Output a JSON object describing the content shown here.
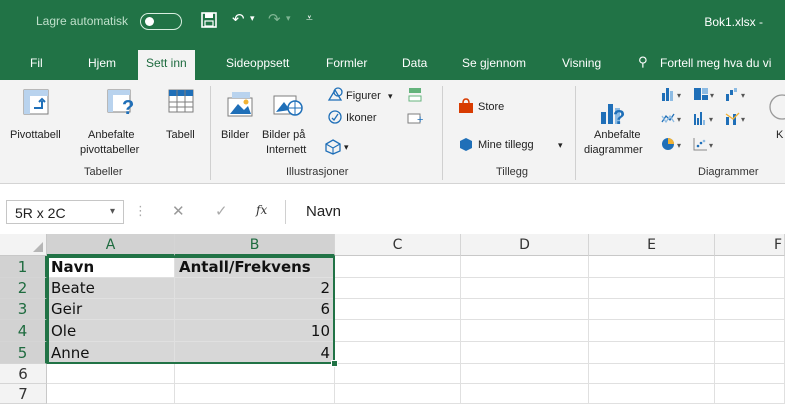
{
  "titlebar": {
    "autosave_label": "Lagre automatisk",
    "autosave_state": "off",
    "filename": "Bok1.xlsx  -"
  },
  "tabs": [
    {
      "label": "Fil"
    },
    {
      "label": "Hjem"
    },
    {
      "label": "Sett inn",
      "active": true
    },
    {
      "label": "Sideoppsett"
    },
    {
      "label": "Formler"
    },
    {
      "label": "Data"
    },
    {
      "label": "Se gjennom"
    },
    {
      "label": "Visning"
    }
  ],
  "tell_me": "Fortell meg hva du vi",
  "ribbon": {
    "tables": {
      "pivot": "Pivottabell",
      "recommended_pivot_1": "Anbefalte",
      "recommended_pivot_2": "pivottabeller",
      "table": "Tabell",
      "group": "Tabeller"
    },
    "illustrations": {
      "pictures": "Bilder",
      "online_pictures_1": "Bilder på",
      "online_pictures_2": "Internett",
      "shapes": "Figurer",
      "icons": "Ikoner",
      "group": "Illustrasjoner"
    },
    "addins": {
      "store": "Store",
      "my_addins": "Mine tillegg",
      "group": "Tillegg"
    },
    "charts": {
      "recommended_1": "Anbefalte",
      "recommended_2": "diagrammer",
      "group": "Diagrammer"
    }
  },
  "formula_bar": {
    "name_box": "5R x 2C",
    "fx": "fx",
    "value": "Navn"
  },
  "grid": {
    "columns": [
      "A",
      "B",
      "C",
      "D",
      "E",
      "F"
    ],
    "rows": [
      "1",
      "2",
      "3",
      "4",
      "5",
      "6",
      "7"
    ],
    "cells": [
      [
        "Navn",
        "Antall/Frekvens"
      ],
      [
        "Beate",
        "2"
      ],
      [
        "Geir",
        "6"
      ],
      [
        "Ole",
        "10"
      ],
      [
        "Anne",
        "4"
      ]
    ]
  }
}
